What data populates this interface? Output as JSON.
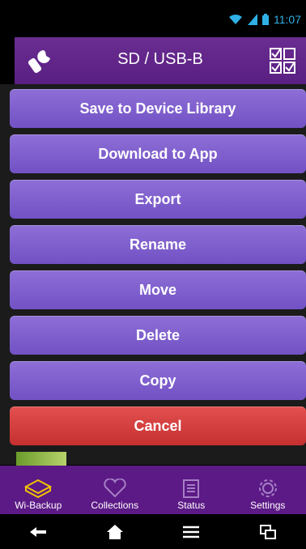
{
  "status": {
    "time": "11:07"
  },
  "appbar": {
    "title": "SD / USB-B"
  },
  "menu": {
    "items": [
      {
        "label": "Save to Device Library"
      },
      {
        "label": "Download to App"
      },
      {
        "label": "Export"
      },
      {
        "label": "Rename"
      },
      {
        "label": "Move"
      },
      {
        "label": "Delete"
      },
      {
        "label": "Copy"
      },
      {
        "label": "Cancel"
      }
    ]
  },
  "bottom_nav": {
    "items": [
      {
        "label": "Wi-Backup"
      },
      {
        "label": "Collections"
      },
      {
        "label": "Status"
      },
      {
        "label": "Settings"
      }
    ]
  },
  "colors": {
    "accent": "#6a2d91",
    "menu_button": "#7f5fcf",
    "cancel": "#d63c3c",
    "status_icons": "#2fb0e6"
  }
}
